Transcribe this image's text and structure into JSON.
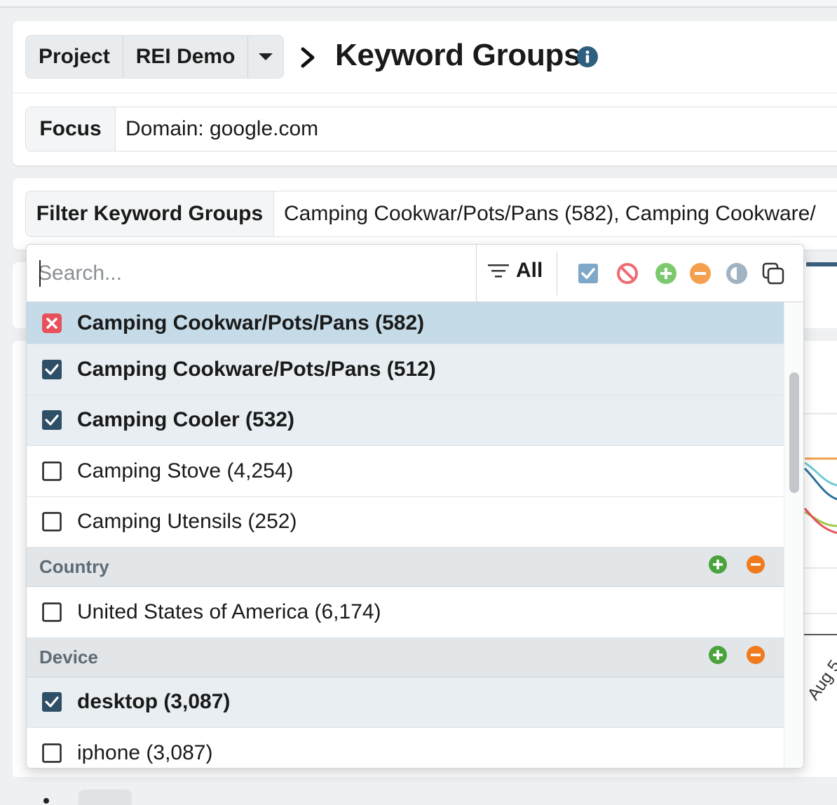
{
  "header": {
    "project_label": "Project",
    "project_value": "REI Demo",
    "title": "Keyword Groups",
    "focus_label": "Focus",
    "focus_value": "Domain: google.com"
  },
  "filter": {
    "label": "Filter Keyword Groups",
    "value": "Camping Cookwar/Pots/Pans (582), Camping Cookware/"
  },
  "dropdown": {
    "search_placeholder": "Search...",
    "all_label": "All",
    "tool_icons": [
      "check-all-icon",
      "exclude-icon",
      "add-all-icon",
      "remove-all-icon",
      "invert-icon",
      "copy-icon"
    ],
    "items": [
      {
        "label": "Camping Cookwar/Pots/Pans (582)",
        "state": "excluded"
      },
      {
        "label": "Camping Cookware/Pots/Pans (512)",
        "state": "checked"
      },
      {
        "label": "Camping Cooler (532)",
        "state": "checked"
      },
      {
        "label": "Camping Stove (4,254)",
        "state": "unchecked"
      },
      {
        "label": "Camping Utensils (252)",
        "state": "unchecked"
      }
    ],
    "sections": [
      {
        "label": "Country",
        "items": [
          {
            "label": "United States of America (6,174)",
            "state": "unchecked"
          }
        ]
      },
      {
        "label": "Device",
        "items": [
          {
            "label": "desktop (3,087)",
            "state": "checked"
          },
          {
            "label": "iphone (3,087)",
            "state": "unchecked"
          }
        ]
      }
    ]
  },
  "background": {
    "axis_tick_fragment": "Aug 5"
  },
  "colors": {
    "checkbox": "#2f4f66",
    "excluded": "#e8505b",
    "add": "#4aa33c",
    "remove": "#f07a1c",
    "info": "#2e5f80"
  }
}
